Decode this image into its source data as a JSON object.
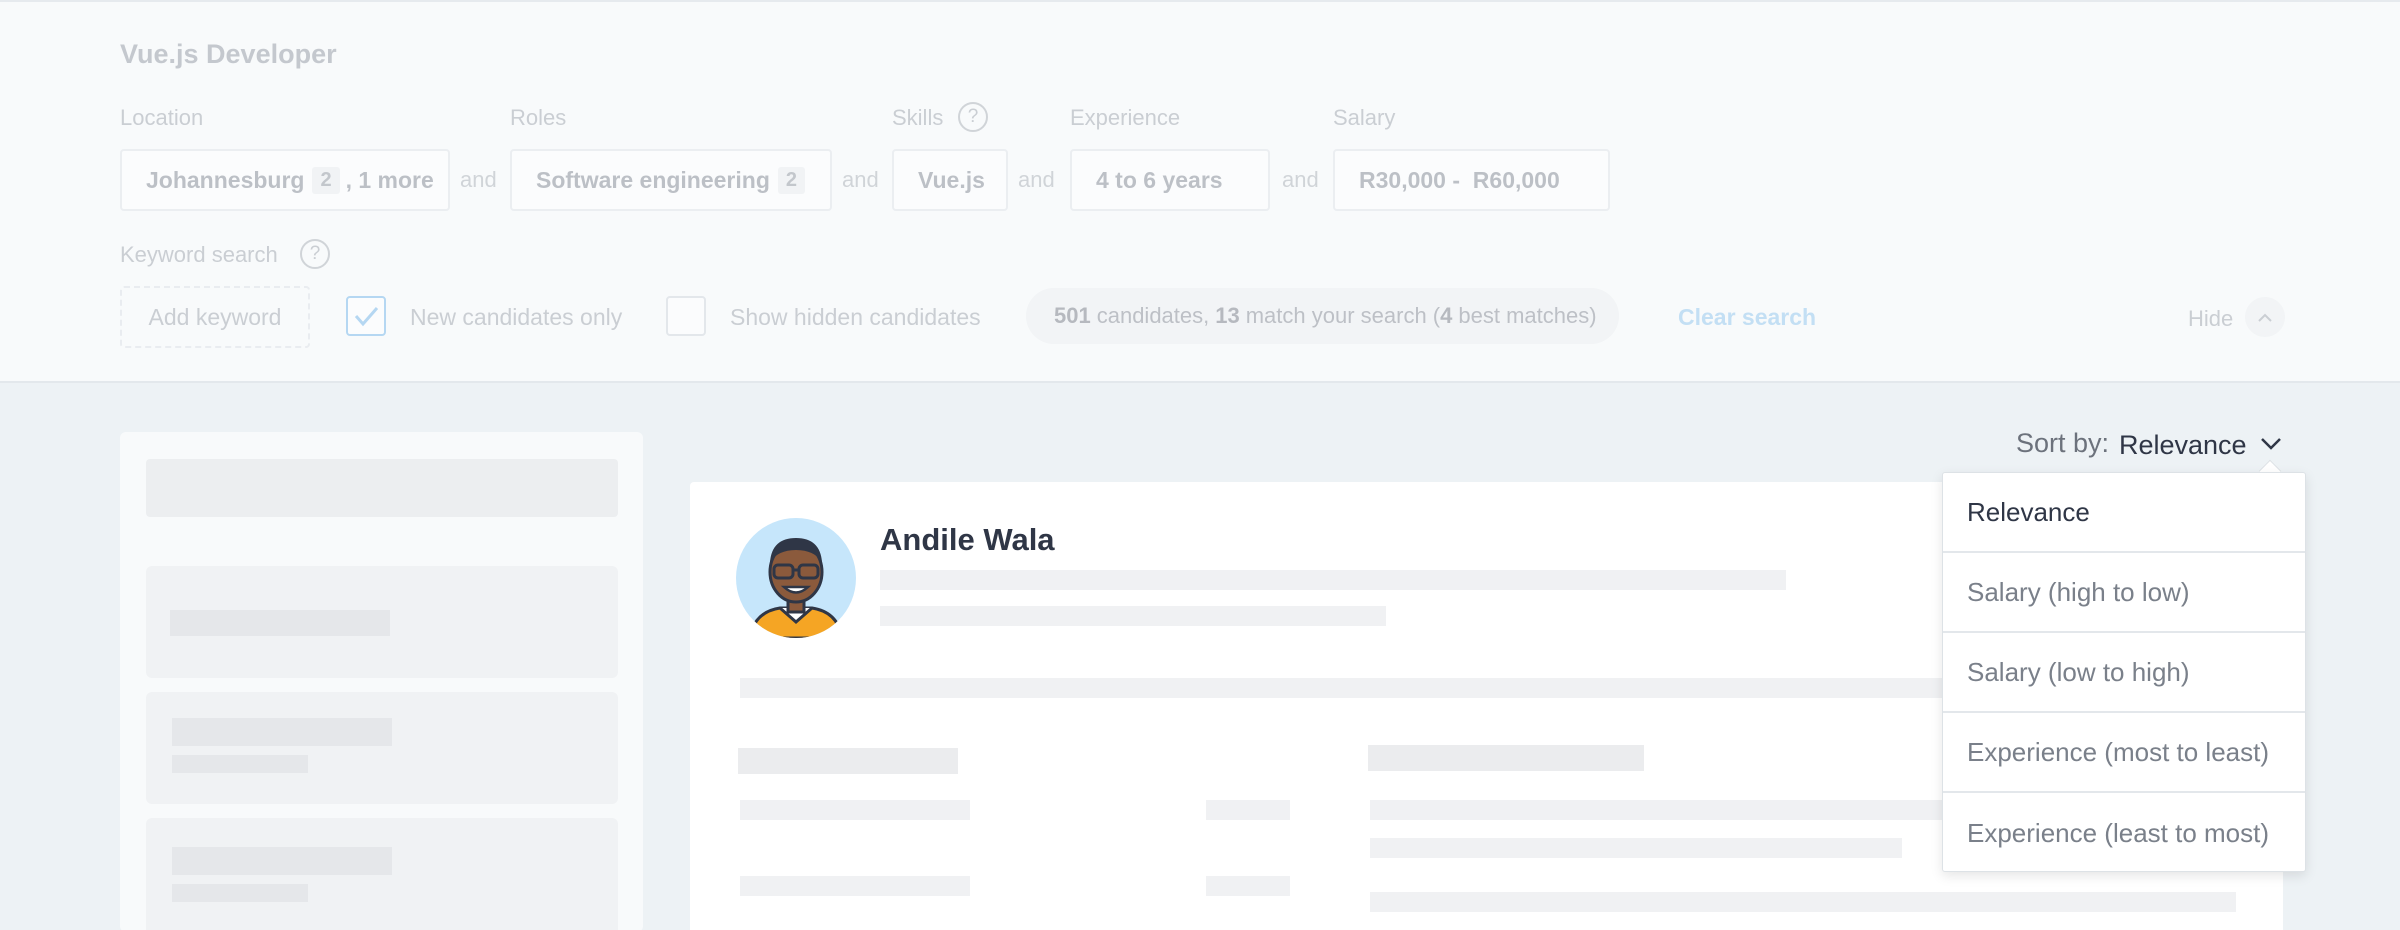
{
  "search": {
    "title": "Vue.js Developer",
    "location": {
      "label": "Location",
      "value": "Johannesburg",
      "count": "2",
      "extra": ", 1 more"
    },
    "roles": {
      "label": "Roles",
      "value": "Software engineering",
      "count": "2"
    },
    "skills": {
      "label": "Skills",
      "help": "?",
      "value": "Vue.js"
    },
    "experience": {
      "label": "Experience",
      "value": "4 to 6 years"
    },
    "salary": {
      "label": "Salary",
      "value": "R30,000 -  R60,000"
    },
    "and_text": "and",
    "keyword": {
      "label": "Keyword search",
      "help": "?",
      "placeholder": "Add keyword"
    },
    "new_candidates_only": {
      "label": "New candidates only",
      "checked": true
    },
    "show_hidden": {
      "label": "Show hidden candidates",
      "checked": false
    },
    "match_summary": {
      "total": "501",
      "t1": "candidates,",
      "matches": "13",
      "t2": "match your search (",
      "best": "4",
      "t3": "best matches)"
    },
    "clear_label": "Clear search",
    "hide_label": "Hide"
  },
  "sort": {
    "label": "Sort by:",
    "value": "Relevance",
    "options": [
      "Relevance",
      "Salary (high to low)",
      "Salary (low to high)",
      "Experience (most to least)",
      "Experience (least to most)"
    ]
  },
  "candidate": {
    "name": "Andile Wala"
  },
  "colors": {
    "link": "#7ab9ea",
    "check": "#5aa7e4",
    "avatar_bg": "#c6e6fb",
    "shirt": "#f5a524"
  }
}
